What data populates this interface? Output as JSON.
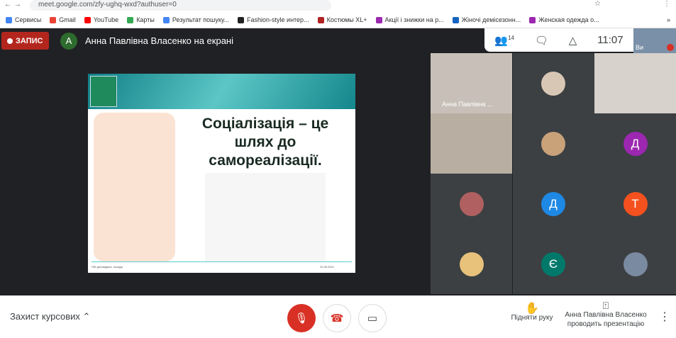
{
  "browser": {
    "url": "meet.google.com/zfy-ughq-wxd?authuser=0",
    "bookmarks": [
      {
        "label": "Сервисы",
        "color": "#4285f4"
      },
      {
        "label": "Gmail",
        "color": "#ea4335"
      },
      {
        "label": "YouTube",
        "color": "#ff0000"
      },
      {
        "label": "Карты",
        "color": "#34a853"
      },
      {
        "label": "Результат пошуку...",
        "color": "#4285f4"
      },
      {
        "label": "Fashion-style интер...",
        "color": "#222222"
      },
      {
        "label": "Костюмы XL+",
        "color": "#b22222"
      },
      {
        "label": "Акції і знижки на р...",
        "color": "#9c27b0"
      },
      {
        "label": "Жіночі демісезонн...",
        "color": "#1565c0"
      },
      {
        "label": "Женская одежда о...",
        "color": "#9c27b0"
      }
    ],
    "more": "»"
  },
  "header": {
    "record_label": "ЗАПИС",
    "presenter_initial": "А",
    "title": "Анна Павлівна Власенко на екрані",
    "participants_count": "14",
    "time": "11:07",
    "self_label": "Ви"
  },
  "slide": {
    "title": "Соціалізація – це шлях до самореалізації.",
    "footer_left": "ПІБ доповідача, посада",
    "footer_right": "22.05.2021"
  },
  "tiles": [
    {
      "type": "video",
      "name": "Анна Павлівна ...",
      "bg": "#c8c0b8"
    },
    {
      "type": "photo",
      "bg": "#d9c7b5"
    },
    {
      "type": "video",
      "bg": "#d8d2cc"
    },
    {
      "type": "video",
      "bg": "#b9aea2"
    },
    {
      "type": "photo",
      "bg": "#c9a27a"
    },
    {
      "type": "initial",
      "initial": "Д",
      "color": "#9c27b0"
    },
    {
      "type": "photo",
      "bg": "#b06060"
    },
    {
      "type": "initial",
      "initial": "Д",
      "color": "#1e88e5"
    },
    {
      "type": "initial",
      "initial": "Т",
      "color": "#f4511e"
    },
    {
      "type": "photo",
      "bg": "#e8c27a"
    },
    {
      "type": "initial",
      "initial": "Є",
      "color": "#00796b"
    },
    {
      "type": "photo",
      "bg": "#7a8aa0"
    }
  ],
  "bottom": {
    "meeting_name": "Захист курсових",
    "raise_hand": "Підняти руку",
    "presenting": "Анна Павлівна Власенко проводить презентацію"
  }
}
